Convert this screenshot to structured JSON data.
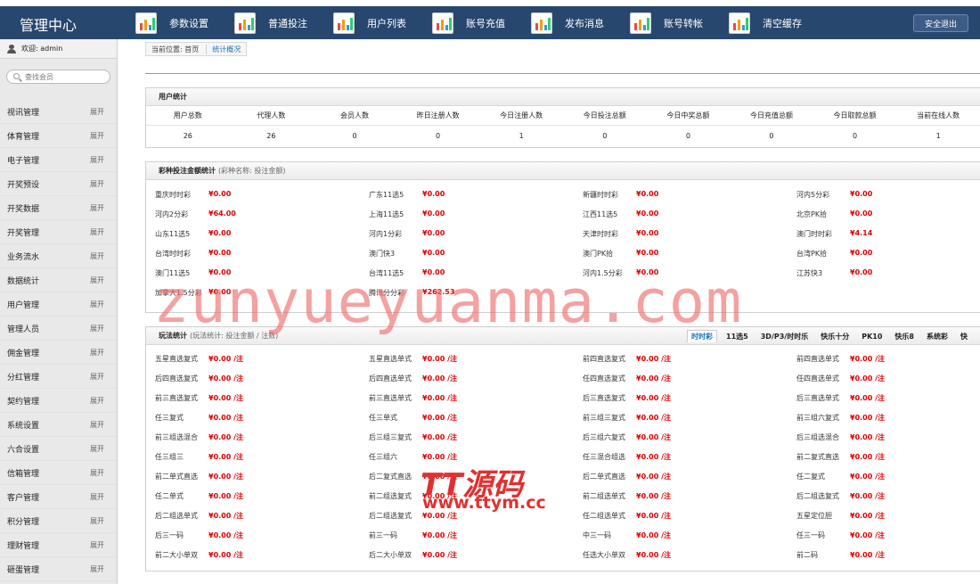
{
  "app_title": "管理中心",
  "top_nav": [
    "参数设置",
    "普通投注",
    "用户列表",
    "账号充值",
    "发布消息",
    "账号转帐",
    "清空缓存"
  ],
  "logout_label": "安全退出",
  "welcome": "欢迎: admin",
  "search_placeholder": "查找会员",
  "sidebar": [
    {
      "label": "视讯管理",
      "action": "展开"
    },
    {
      "label": "体育管理",
      "action": "展开"
    },
    {
      "label": "电子管理",
      "action": "展开"
    },
    {
      "label": "开奖预设",
      "action": "展开"
    },
    {
      "label": "开奖数据",
      "action": "展开"
    },
    {
      "label": "开奖管理",
      "action": "展开"
    },
    {
      "label": "业务流水",
      "action": "展开"
    },
    {
      "label": "数据统计",
      "action": "展开"
    },
    {
      "label": "用户管理",
      "action": "展开"
    },
    {
      "label": "管理人员",
      "action": "展开"
    },
    {
      "label": "佣金管理",
      "action": "展开"
    },
    {
      "label": "分红管理",
      "action": "展开"
    },
    {
      "label": "契约管理",
      "action": "展开"
    },
    {
      "label": "系统设置",
      "action": "展开"
    },
    {
      "label": "六合设置",
      "action": "展开"
    },
    {
      "label": "信箱管理",
      "action": "展开"
    },
    {
      "label": "客户管理",
      "action": "展开"
    },
    {
      "label": "积分管理",
      "action": "展开"
    },
    {
      "label": "理财管理",
      "action": "展开"
    },
    {
      "label": "砸蛋管理",
      "action": "展开"
    }
  ],
  "breadcrumb": {
    "prefix": "当前位置: 首页",
    "current": "统计概况"
  },
  "user_stats": {
    "title": "用户统计",
    "headers": [
      "用户总数",
      "代理人数",
      "会员人数",
      "昨日注册人数",
      "今日注册人数",
      "今日投注总额",
      "今日中奖总额",
      "今日充值总额",
      "今日取款总额",
      "当前在线人数"
    ],
    "values": [
      "26",
      "26",
      "0",
      "0",
      "1",
      "0",
      "0",
      "0",
      "0",
      "1"
    ]
  },
  "lottery_stats": {
    "title": "彩种投注金额统计",
    "subtitle": "(彩种名称: 投注金额)",
    "items": [
      {
        "name": "重庆时时彩",
        "amount": "¥0.00"
      },
      {
        "name": "广东11选5",
        "amount": "¥0.00"
      },
      {
        "name": "新疆时时彩",
        "amount": "¥0.00"
      },
      {
        "name": "河内5分彩",
        "amount": "¥0.00"
      },
      {
        "name": "河内2分彩",
        "amount": "¥64.00"
      },
      {
        "name": "上海11选5",
        "amount": "¥0.00"
      },
      {
        "name": "江西11选5",
        "amount": "¥0.00"
      },
      {
        "name": "北京PK拾",
        "amount": "¥0.00"
      },
      {
        "name": "山东11选5",
        "amount": "¥0.00"
      },
      {
        "name": "河内1分彩",
        "amount": "¥0.00"
      },
      {
        "name": "天津时时彩",
        "amount": "¥0.00"
      },
      {
        "name": "澳门时时彩",
        "amount": "¥4.14"
      },
      {
        "name": "台湾时时彩",
        "amount": "¥0.00"
      },
      {
        "name": "澳门快3",
        "amount": "¥0.00"
      },
      {
        "name": "澳门PK拾",
        "amount": "¥0.00"
      },
      {
        "name": "台湾PK拾",
        "amount": "¥0.00"
      },
      {
        "name": "澳门11选5",
        "amount": "¥0.00"
      },
      {
        "name": "台湾11选5",
        "amount": "¥0.00"
      },
      {
        "name": "河内1.5分彩",
        "amount": "¥0.00"
      },
      {
        "name": "江苏快3",
        "amount": "¥0.00"
      },
      {
        "name": "加拿大1.5分彩",
        "amount": "¥0.00"
      },
      {
        "name": "腾讯分分彩",
        "amount": "¥262.53"
      }
    ]
  },
  "play_stats": {
    "title": "玩法统计",
    "subtitle": "(玩法统计: 投注金额 / 注数)",
    "tabs": [
      "时时彩",
      "11选5",
      "3D/P3/时时乐",
      "快乐十分",
      "PK10",
      "快乐8",
      "系统彩",
      "快"
    ],
    "active_tab": 0,
    "items": [
      {
        "name": "五星直选复式",
        "amount": "¥0.00 /",
        "unit": "注"
      },
      {
        "name": "五星直选单式",
        "amount": "¥0.00 /",
        "unit": "注"
      },
      {
        "name": "前四直选复式",
        "amount": "¥0.00 /",
        "unit": "注"
      },
      {
        "name": "前四直选单式",
        "amount": "¥0.00 /",
        "unit": "注"
      },
      {
        "name": "后四直选复式",
        "amount": "¥0.00 /",
        "unit": "注"
      },
      {
        "name": "后四直选单式",
        "amount": "¥0.00 /",
        "unit": "注"
      },
      {
        "name": "任四直选复式",
        "amount": "¥0.00 /",
        "unit": "注"
      },
      {
        "name": "任四直选单式",
        "amount": "¥0.00 /",
        "unit": "注"
      },
      {
        "name": "前三直选复式",
        "amount": "¥0.00 /",
        "unit": "注"
      },
      {
        "name": "前三直选单式",
        "amount": "¥0.00 /",
        "unit": "注"
      },
      {
        "name": "后三直选复式",
        "amount": "¥0.00 /",
        "unit": "注"
      },
      {
        "name": "后三直选单式",
        "amount": "¥0.00 /",
        "unit": "注"
      },
      {
        "name": "任三复式",
        "amount": "¥0.00 /",
        "unit": "注"
      },
      {
        "name": "任三单式",
        "amount": "¥0.00 /",
        "unit": "注"
      },
      {
        "name": "前三组三复式",
        "amount": "¥0.00 /",
        "unit": "注"
      },
      {
        "name": "前三组六复式",
        "amount": "¥0.00 /",
        "unit": "注"
      },
      {
        "name": "前三组选混合",
        "amount": "¥0.00 /",
        "unit": "注"
      },
      {
        "name": "后三组三复式",
        "amount": "¥0.00 /",
        "unit": "注"
      },
      {
        "name": "后三组六复式",
        "amount": "¥0.00 /",
        "unit": "注"
      },
      {
        "name": "后三组选混合",
        "amount": "¥0.00 /",
        "unit": "注"
      },
      {
        "name": "任三组三",
        "amount": "¥0.00 /",
        "unit": "注"
      },
      {
        "name": "任三组六",
        "amount": "¥0.00 /",
        "unit": "注"
      },
      {
        "name": "任三混合组选",
        "amount": "¥0.00 /",
        "unit": "注"
      },
      {
        "name": "前二复式直选",
        "amount": "¥0.00 /",
        "unit": "注"
      },
      {
        "name": "前二单式直选",
        "amount": "¥0.00 /",
        "unit": "注"
      },
      {
        "name": "后二复式直选",
        "amount": "¥0.00 /",
        "unit": "注"
      },
      {
        "name": "后二单式直选",
        "amount": "¥0.00 /",
        "unit": "注"
      },
      {
        "name": "任二复式",
        "amount": "¥0.00 /",
        "unit": "注"
      },
      {
        "name": "任二单式",
        "amount": "¥0.00 /",
        "unit": "注"
      },
      {
        "name": "前二组选复式",
        "amount": "¥0.00 /",
        "unit": "注"
      },
      {
        "name": "前二组选单式",
        "amount": "¥0.00 /",
        "unit": "注"
      },
      {
        "name": "后二组选复式",
        "amount": "¥0.00 /",
        "unit": "注"
      },
      {
        "name": "后二组选单式",
        "amount": "¥0.00 /",
        "unit": "注"
      },
      {
        "name": "后二组选复式",
        "amount": "¥0.00 /",
        "unit": "注"
      },
      {
        "name": "任二组选单式",
        "amount": "¥0.00 /",
        "unit": "注"
      },
      {
        "name": "五星定位胆",
        "amount": "¥0.00 /",
        "unit": "注"
      },
      {
        "name": "后三一码",
        "amount": "¥0.00 /",
        "unit": "注"
      },
      {
        "name": "前三一码",
        "amount": "¥0.00 /",
        "unit": "注"
      },
      {
        "name": "中三一码",
        "amount": "¥0.00 /",
        "unit": "注"
      },
      {
        "name": "任三一码",
        "amount": "¥0.00 /",
        "unit": "注"
      },
      {
        "name": "前二大小单双",
        "amount": "¥0.00 /",
        "unit": "注"
      },
      {
        "name": "后二大小单双",
        "amount": "¥0.00 /",
        "unit": "注"
      },
      {
        "name": "任选大小单双",
        "amount": "¥0.00 /",
        "unit": "注"
      },
      {
        "name": "前二码",
        "amount": "¥0.00 /",
        "unit": "注"
      }
    ]
  },
  "watermarks": {
    "main": "zunyueyuanma.com",
    "brand": "TT源码",
    "url": "www.ttym.cc"
  },
  "colors": {
    "topbar": "#27476f",
    "amount_red": "#e00000",
    "link_blue": "#1a73b8",
    "watermark": "#e23030"
  }
}
